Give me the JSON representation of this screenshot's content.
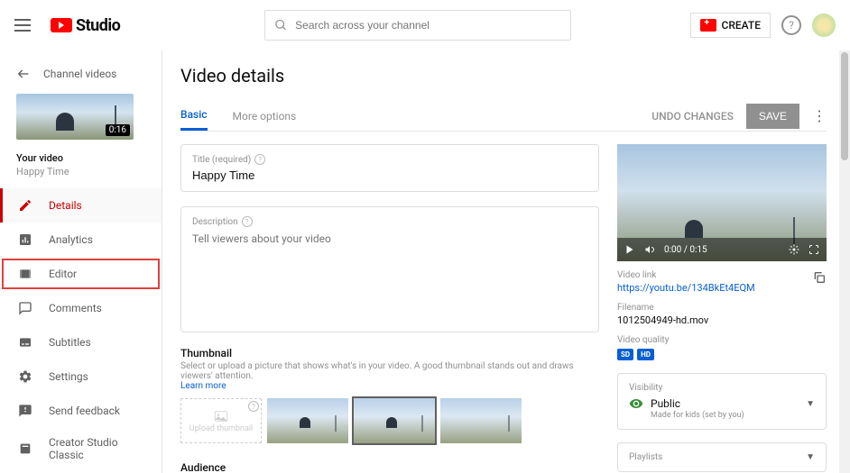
{
  "header": {
    "logo_text": "Studio",
    "search_placeholder": "Search across your channel",
    "create_label": "CREATE"
  },
  "sidebar": {
    "back_label": "Channel videos",
    "duration": "0:16",
    "your_video_label": "Your video",
    "video_title": "Happy Time",
    "items": [
      {
        "label": "Details"
      },
      {
        "label": "Analytics"
      },
      {
        "label": "Editor"
      },
      {
        "label": "Comments"
      },
      {
        "label": "Subtitles"
      }
    ],
    "bottom": [
      {
        "label": "Settings"
      },
      {
        "label": "Send feedback"
      },
      {
        "label": "Creator Studio Classic"
      }
    ]
  },
  "page": {
    "title": "Video details",
    "tabs": [
      {
        "label": "Basic"
      },
      {
        "label": "More options"
      }
    ],
    "undo_label": "UNDO CHANGES",
    "save_label": "SAVE"
  },
  "form": {
    "title_label": "Title (required)",
    "title_value": "Happy Time",
    "desc_label": "Description",
    "desc_placeholder": "Tell viewers about your video",
    "thumb_heading": "Thumbnail",
    "thumb_sub": "Select or upload a picture that shows what's in your video. A good thumbnail stands out and draws viewers' attention.",
    "learn_more": "Learn more",
    "upload_thumb": "Upload thumbnail",
    "audience_heading": "Audience"
  },
  "preview": {
    "time": "0:00 / 0:15",
    "link_label": "Video link",
    "link_value": "https://youtu.be/134BkEt4EQM",
    "filename_label": "Filename",
    "filename_value": "1012504949-hd.mov",
    "quality_label": "Video quality",
    "quality_badges": [
      "SD",
      "HD"
    ],
    "visibility_label": "Visibility",
    "visibility_value": "Public",
    "visibility_sub": "Made for kids (set by you)",
    "playlists_label": "Playlists"
  }
}
